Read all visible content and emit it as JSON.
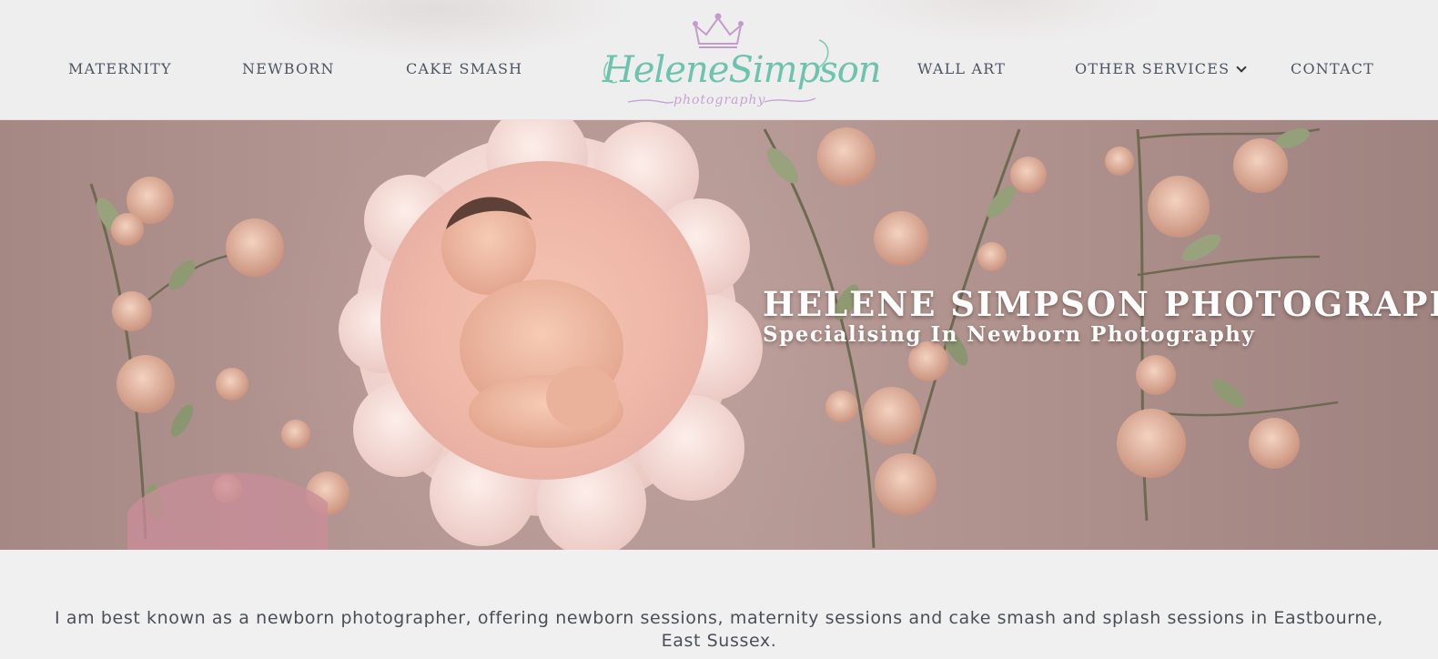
{
  "nav": {
    "left": [
      {
        "label": "MATERNITY"
      },
      {
        "label": "NEWBORN"
      },
      {
        "label": "CAKE SMASH"
      }
    ],
    "right": [
      {
        "label": "WALL ART"
      },
      {
        "label": "OTHER SERVICES"
      },
      {
        "label": "CONTACT"
      }
    ]
  },
  "logo": {
    "script": "HeleneSimpson",
    "sub": "photography",
    "colors": {
      "script": "#6cc3ae",
      "accent": "#c7a2d2"
    }
  },
  "hero": {
    "title": "HELENE SIMPSON PHOTOGRAPHY",
    "subtitle": "Specialising In Newborn Photography"
  },
  "intro": {
    "text": "I am best known as a newborn photographer, offering newborn sessions, maternity sessions and cake smash and splash sessions in Eastbourne, East Sussex."
  }
}
